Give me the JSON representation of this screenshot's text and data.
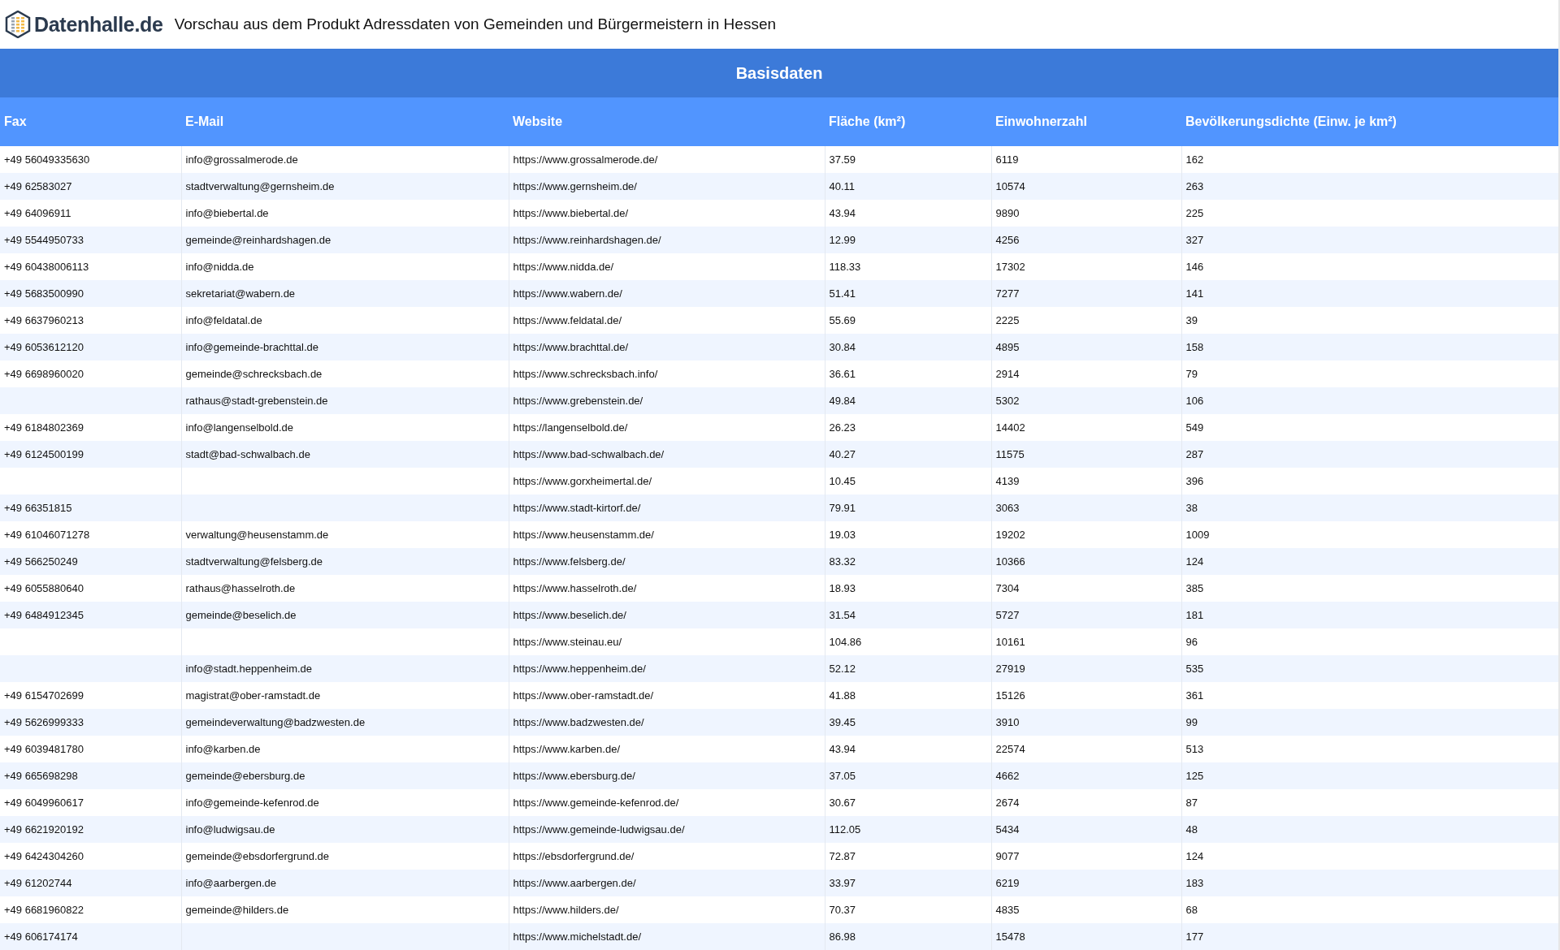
{
  "header": {
    "logo_text": "Datenhalle.de",
    "title": "Vorschau aus dem Produkt Adressdaten von Gemeinden und Bürgermeistern in Hessen"
  },
  "section": {
    "title": "Basisdaten"
  },
  "table": {
    "columns": [
      "Fax",
      "E-Mail",
      "Website",
      "Fläche (km²)",
      "Einwohnerzahl",
      "Bevölkerungsdichte (Einw. je km²)"
    ],
    "rows": [
      {
        "fax": "+49 56049335630",
        "email": "info@grossalmerode.de",
        "website": "https://www.grossalmerode.de/",
        "area": "37.59",
        "population": "6119",
        "density": "162"
      },
      {
        "fax": "+49 62583027",
        "email": "stadtverwaltung@gernsheim.de",
        "website": "https://www.gernsheim.de/",
        "area": "40.11",
        "population": "10574",
        "density": "263"
      },
      {
        "fax": "+49 64096911",
        "email": "info@biebertal.de",
        "website": "https://www.biebertal.de/",
        "area": "43.94",
        "population": "9890",
        "density": "225"
      },
      {
        "fax": "+49 5544950733",
        "email": "gemeinde@reinhardshagen.de",
        "website": "https://www.reinhardshagen.de/",
        "area": "12.99",
        "population": "4256",
        "density": "327"
      },
      {
        "fax": "+49 60438006113",
        "email": "info@nidda.de",
        "website": "https://www.nidda.de/",
        "area": "118.33",
        "population": "17302",
        "density": "146"
      },
      {
        "fax": "+49 5683500990",
        "email": "sekretariat@wabern.de",
        "website": "https://www.wabern.de/",
        "area": "51.41",
        "population": "7277",
        "density": "141"
      },
      {
        "fax": "+49 6637960213",
        "email": "info@feldatal.de",
        "website": "https://www.feldatal.de/",
        "area": "55.69",
        "population": "2225",
        "density": "39"
      },
      {
        "fax": "+49 6053612120",
        "email": "info@gemeinde-brachttal.de",
        "website": "https://www.brachttal.de/",
        "area": "30.84",
        "population": "4895",
        "density": "158"
      },
      {
        "fax": "+49 6698960020",
        "email": "gemeinde@schrecksbach.de",
        "website": "https://www.schrecksbach.info/",
        "area": "36.61",
        "population": "2914",
        "density": "79"
      },
      {
        "email": "rathaus@stadt-grebenstein.de",
        "website": "https://www.grebenstein.de/",
        "area": "49.84",
        "population": "5302",
        "density": "106"
      },
      {
        "fax": "+49 6184802369",
        "email": "info@langenselbold.de",
        "website": "https://langenselbold.de/",
        "area": "26.23",
        "population": "14402",
        "density": "549"
      },
      {
        "fax": "+49 6124500199",
        "email": "stadt@bad-schwalbach.de",
        "website": "https://www.bad-schwalbach.de/",
        "area": "40.27",
        "population": "11575",
        "density": "287"
      },
      {
        "website": "https://www.gorxheimertal.de/",
        "area": "10.45",
        "population": "4139",
        "density": "396"
      },
      {
        "fax": "+49 66351815",
        "website": "https://www.stadt-kirtorf.de/",
        "area": "79.91",
        "population": "3063",
        "density": "38"
      },
      {
        "fax": "+49 61046071278",
        "email": "verwaltung@heusenstamm.de",
        "website": "https://www.heusenstamm.de/",
        "area": "19.03",
        "population": "19202",
        "density": "1009"
      },
      {
        "fax": "+49 566250249",
        "email": "stadtverwaltung@felsberg.de",
        "website": "https://www.felsberg.de/",
        "area": "83.32",
        "population": "10366",
        "density": "124"
      },
      {
        "fax": "+49 6055880640",
        "email": "rathaus@hasselroth.de",
        "website": "https://www.hasselroth.de/",
        "area": "18.93",
        "population": "7304",
        "density": "385"
      },
      {
        "fax": "+49 6484912345",
        "email": "gemeinde@beselich.de",
        "website": "https://www.beselich.de/",
        "area": "31.54",
        "population": "5727",
        "density": "181"
      },
      {
        "website": "https://www.steinau.eu/",
        "area": "104.86",
        "population": "10161",
        "density": "96"
      },
      {
        "email": "info@stadt.heppenheim.de",
        "website": "https://www.heppenheim.de/",
        "area": "52.12",
        "population": "27919",
        "density": "535"
      },
      {
        "fax": "+49 6154702699",
        "email": "magistrat@ober-ramstadt.de",
        "website": "https://www.ober-ramstadt.de/",
        "area": "41.88",
        "population": "15126",
        "density": "361"
      },
      {
        "fax": "+49 5626999333",
        "email": "gemeindeverwaltung@badzwesten.de",
        "website": "https://www.badzwesten.de/",
        "area": "39.45",
        "population": "3910",
        "density": "99"
      },
      {
        "fax": "+49 6039481780",
        "email": "info@karben.de",
        "website": "https://www.karben.de/",
        "area": "43.94",
        "population": "22574",
        "density": "513"
      },
      {
        "fax": "+49 665698298",
        "email": "gemeinde@ebersburg.de",
        "website": "https://www.ebersburg.de/",
        "area": "37.05",
        "population": "4662",
        "density": "125"
      },
      {
        "fax": "+49 6049960617",
        "email": "info@gemeinde-kefenrod.de",
        "website": "https://www.gemeinde-kefenrod.de/",
        "area": "30.67",
        "population": "2674",
        "density": "87"
      },
      {
        "fax": "+49 6621920192",
        "email": "info@ludwigsau.de",
        "website": "https://www.gemeinde-ludwigsau.de/",
        "area": "112.05",
        "population": "5434",
        "density": "48"
      },
      {
        "fax": "+49 6424304260",
        "email": "gemeinde@ebsdorfergrund.de",
        "website": "https://ebsdorfergrund.de/",
        "area": "72.87",
        "population": "9077",
        "density": "124"
      },
      {
        "fax": "+49 61202744",
        "email": "info@aarbergen.de",
        "website": "https://www.aarbergen.de/",
        "area": "33.97",
        "population": "6219",
        "density": "183"
      },
      {
        "fax": "+49 6681960822",
        "email": "gemeinde@hilders.de",
        "website": "https://www.hilders.de/",
        "area": "70.37",
        "population": "4835",
        "density": "68"
      },
      {
        "fax": "+49 606174174",
        "website": "https://www.michelstadt.de/",
        "area": "86.98",
        "population": "15478",
        "density": "177"
      }
    ]
  }
}
